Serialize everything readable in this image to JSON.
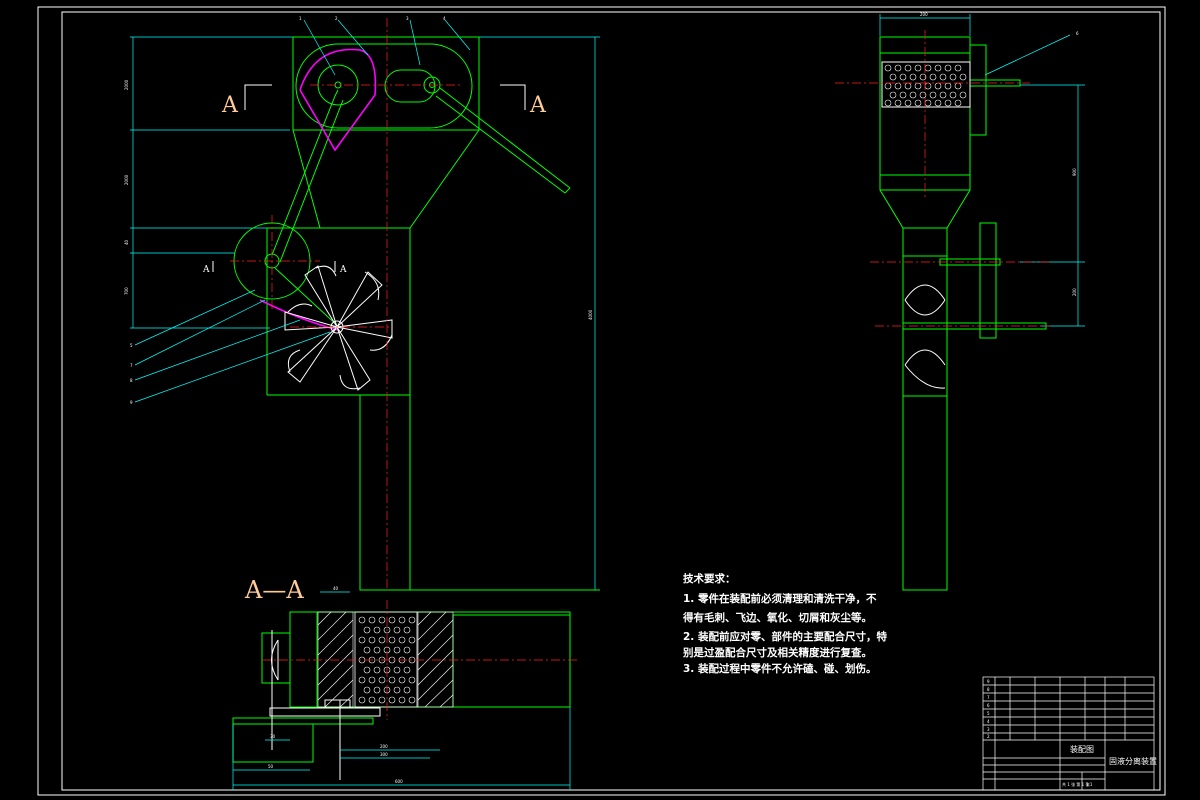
{
  "colors": {
    "background": "#000000",
    "outline": "#00ff00",
    "parts": "#ffffff",
    "centerline": "#ff2020",
    "dimension": "#00ffff",
    "belt": "#ff00ff",
    "section_label": "#ffcc99"
  },
  "section": {
    "mark_left": "A",
    "mark_right": "A",
    "mark_small_left": "A",
    "mark_small_right": "A",
    "view_title": "A—A"
  },
  "balloons": [
    "1",
    "2",
    "3",
    "4",
    "5",
    "6",
    "7",
    "8",
    "9"
  ],
  "technical_requirements": {
    "heading": "技术要求：",
    "lines": [
      "1. 零件在装配前必须清理和清洗干净，不",
      "得有毛刺、飞边、氧化、切屑和灰尘等。",
      "2. 装配前应对零、部件的主要配合尺寸，特",
      "别是过盈配合尺寸及相关精度进行复查。",
      "3. 装配过程中零件不允许磕、碰、划伤。"
    ]
  },
  "title_block": {
    "drawing_type": "装配图",
    "drawing_name": "固液分离装置",
    "scale": "1:1",
    "sheet": "共 1 张  第 1 张"
  }
}
